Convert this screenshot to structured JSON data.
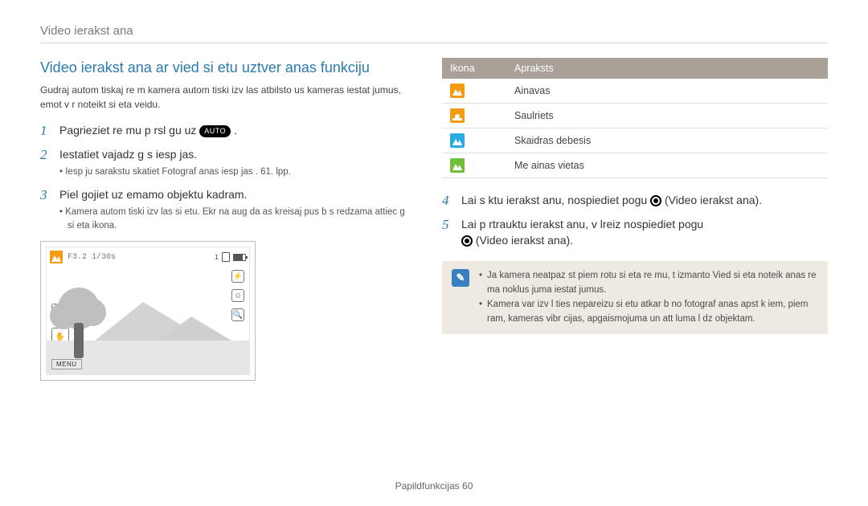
{
  "header": {
    "breadcrumb": "Video ierakst  ana"
  },
  "title": "Video ierakst  ana ar vied  si etu uztver anas funkciju",
  "intro": "Gudraj  autom tiskaj  re  m  kamera autom tiski izv las atbilsto us kameras iestat jumus,  emot v r  noteikt  si eta veidu.",
  "steps": {
    "s1": {
      "num": "1",
      "text_a": "Pagrieziet re  mu p rsl gu uz",
      "text_b": ".",
      "badge": "AUTO"
    },
    "s2": {
      "num": "2",
      "text": "Iestatiet vajadz g s iesp jas.",
      "sub": "Iesp ju sarakstu skatiet  Fotograf  anas iesp jas . 61. lpp."
    },
    "s3": {
      "num": "3",
      "text": "Piel gojiet uz emamo objektu kadram.",
      "sub": "Kamera autom tiski izv las si etu. Ekr na aug da as kreisaj  pus  b s redzama attiec g  si eta ikona."
    },
    "s4": {
      "num": "4",
      "text_a": "Lai s ktu ierakst  anu, nospiediet pogu",
      "text_b": " (Video ierakst  ana)."
    },
    "s5": {
      "num": "5",
      "text_a": "Lai p rtrauktu ierakst  anu, v lreiz nospiediet pogu ",
      "text_b": " (Video ierakst  ana)."
    }
  },
  "screen": {
    "fnum": "F3.2 1/30s",
    "menu": "MENU"
  },
  "table": {
    "head_icon": "Ikona",
    "head_desc": "Apraksts",
    "rows": [
      {
        "label": "Ainavas"
      },
      {
        "label": "Saulriets"
      },
      {
        "label": "Skaidras debesis"
      },
      {
        "label": "Me ainas vietas"
      }
    ]
  },
  "note": {
    "line1": "Ja kamera neatpaz st piem rotu si eta re  mu, t  izmanto Vied  si eta noteik anas re  ma noklus juma iestat jumus.",
    "line2": "Kamera var izv l ties nepareizu si etu atkar b  no fotograf  anas apst k iem, piem ram, kameras vibr cijas, apgaismojuma un att luma l dz objektam."
  },
  "footer": {
    "section": "Papildfunkcijas",
    "page": "60"
  }
}
